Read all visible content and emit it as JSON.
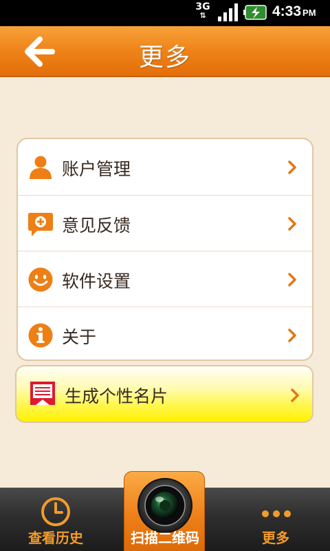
{
  "status_bar": {
    "network": "3G",
    "time": "4:33",
    "ampm": "PM"
  },
  "header": {
    "title": "更多",
    "back_icon": "arrow-left-icon"
  },
  "menu": {
    "items": [
      {
        "label": "账户管理",
        "icon": "user-icon"
      },
      {
        "label": "意见反馈",
        "icon": "feedback-bubble-icon"
      },
      {
        "label": "软件设置",
        "icon": "smiley-icon"
      },
      {
        "label": "关于",
        "icon": "info-icon"
      }
    ]
  },
  "card_button": {
    "label": "生成个性名片",
    "icon": "business-card-icon"
  },
  "bottom_nav": {
    "history": "查看历史",
    "scan": "扫描二维码",
    "more": "更多"
  },
  "colors": {
    "accent": "#ee8318",
    "background": "#f6ead8",
    "card_highlight": "#fff200",
    "nav_text": "#f29b2a"
  }
}
